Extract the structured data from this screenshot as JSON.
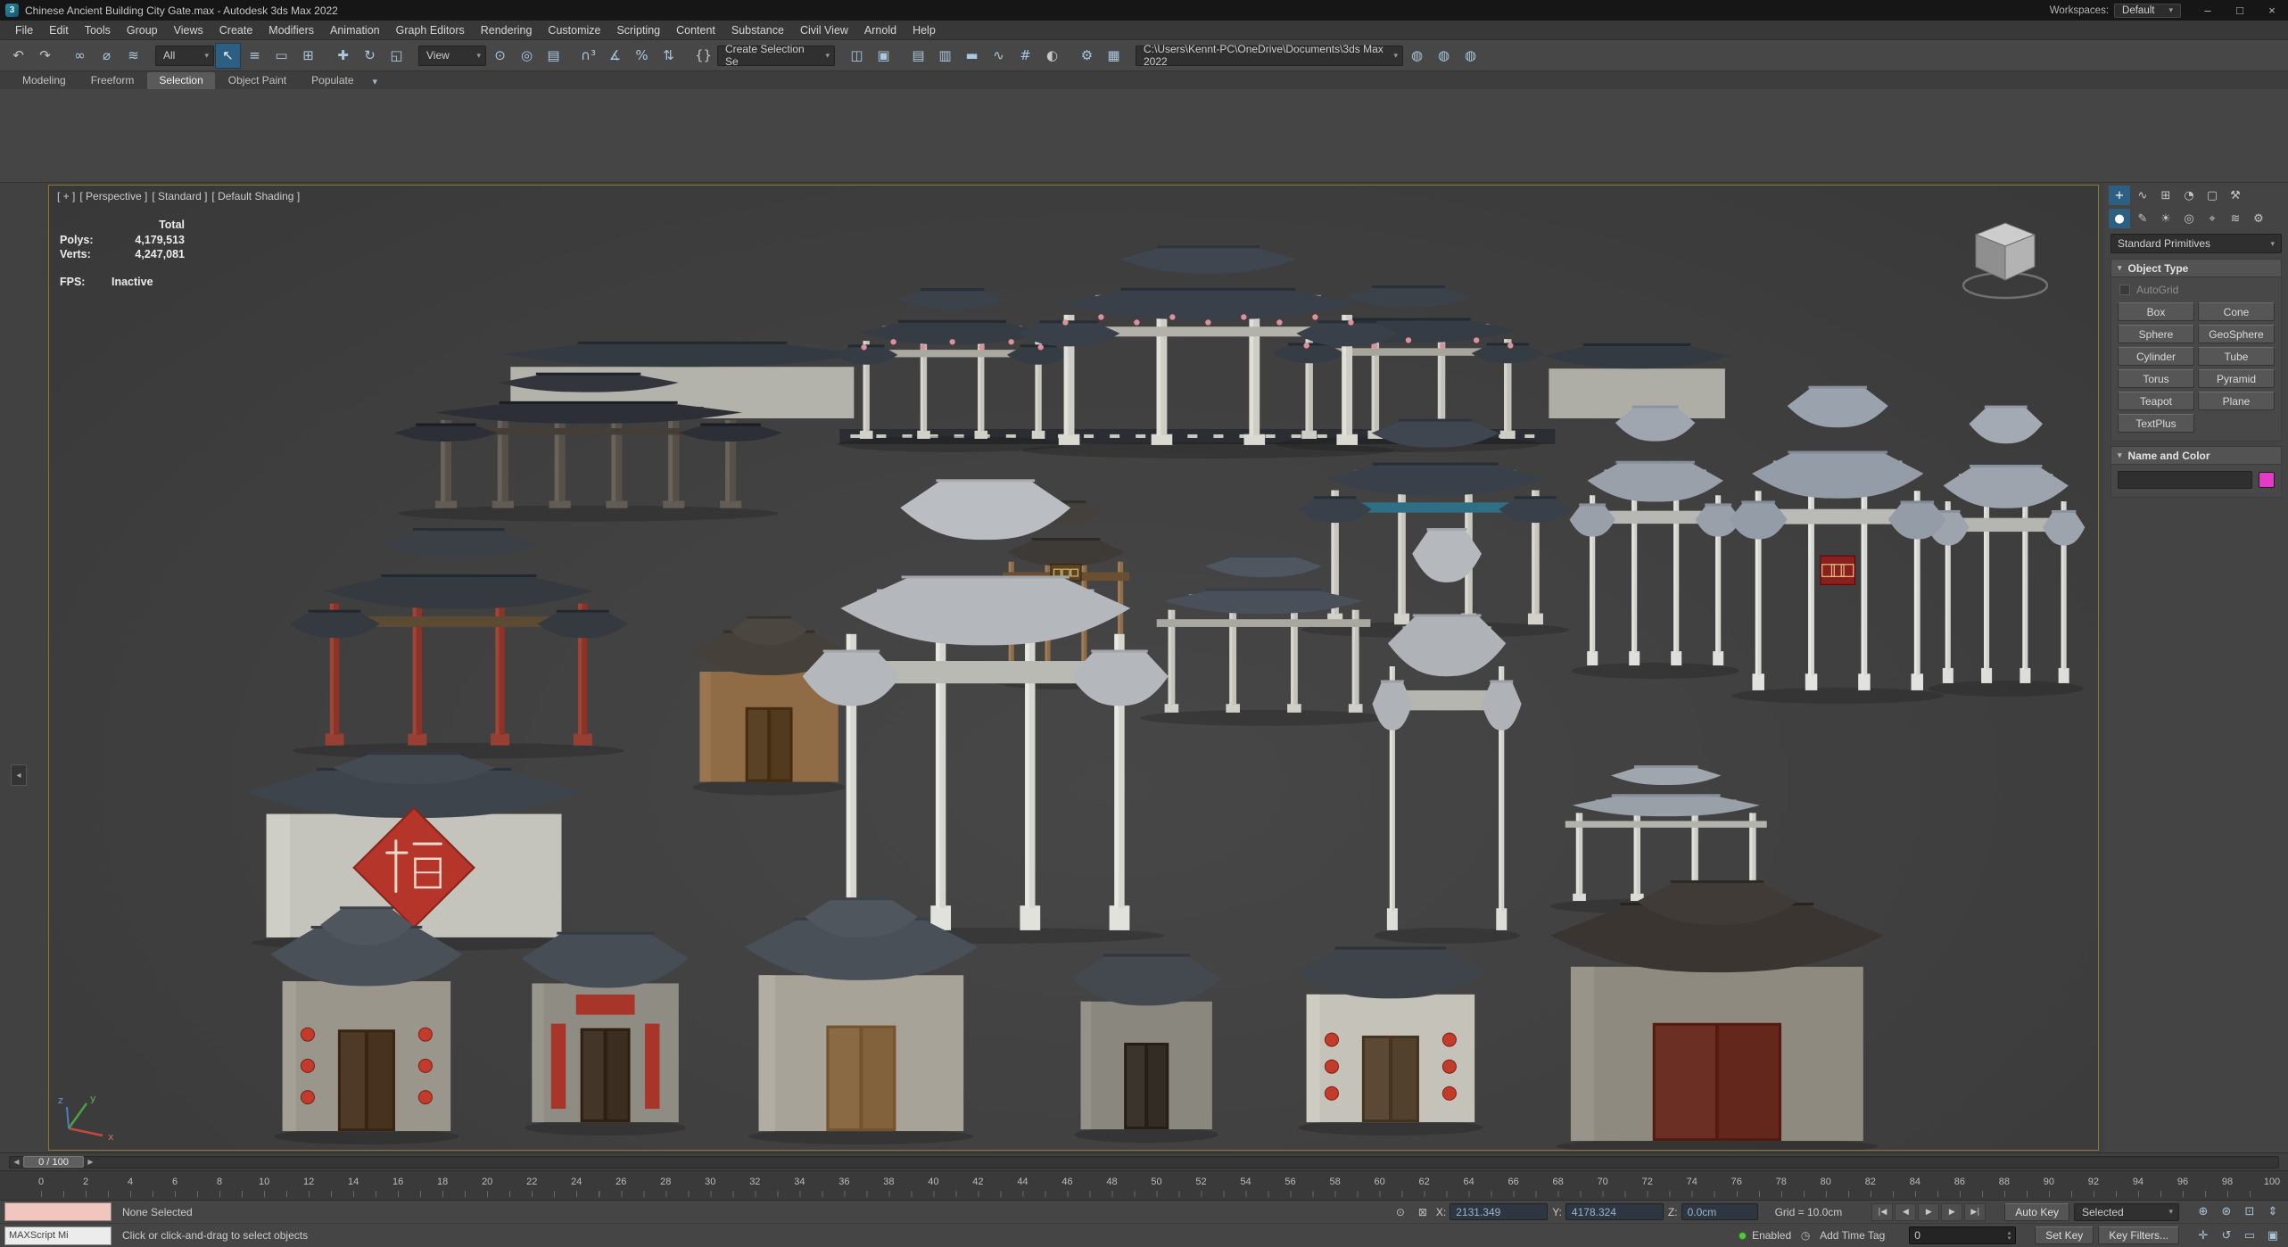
{
  "window": {
    "title": "Chinese Ancient Building City Gate.max - Autodesk 3ds Max 2022",
    "workspaces_label": "Workspaces:",
    "workspaces_value": "Default"
  },
  "menus": [
    "File",
    "Edit",
    "Tools",
    "Group",
    "Views",
    "Create",
    "Modifiers",
    "Animation",
    "Graph Editors",
    "Rendering",
    "Customize",
    "Scripting",
    "Content",
    "Substance",
    "Civil View",
    "Arnold",
    "Help"
  ],
  "toolbar": {
    "selection_filter": "All",
    "ref_coord": "View",
    "selection_set_placeholder": "Create Selection Se",
    "project_path": "C:\\Users\\Kennt-PC\\OneDrive\\Documents\\3ds Max 2022"
  },
  "ribbon": {
    "tabs": [
      "Modeling",
      "Freeform",
      "Selection",
      "Object Paint",
      "Populate"
    ],
    "active_tab": "Selection"
  },
  "viewport": {
    "label_segments": [
      "[ + ]",
      "[ Perspective ]",
      "[ Standard ]",
      "[ Default Shading ]"
    ],
    "stats": {
      "total_label": "Total",
      "polys_label": "Polys:",
      "polys_value": "4,179,513",
      "verts_label": "Verts:",
      "verts_value": "4,247,081",
      "fps_label": "FPS:",
      "fps_value": "Inactive"
    },
    "scene_signs": {
      "diamond_plaque": "福",
      "red_plaque": "越秀山"
    },
    "axis_labels": {
      "x": "x",
      "y": "y",
      "z": "z"
    }
  },
  "command_panel": {
    "primitives_dropdown": "Standard Primitives",
    "object_type_rollout": "Object Type",
    "autogrid_label": "AutoGrid",
    "object_buttons": [
      [
        "Box",
        "Cone"
      ],
      [
        "Sphere",
        "GeoSphere"
      ],
      [
        "Cylinder",
        "Tube"
      ],
      [
        "Torus",
        "Pyramid"
      ],
      [
        "Teapot",
        "Plane"
      ],
      [
        "TextPlus",
        ""
      ]
    ],
    "name_color_rollout": "Name and Color",
    "object_color": "#e23bc8"
  },
  "timeline": {
    "slider_value": "0 / 100",
    "start": 0,
    "end": 100,
    "label_step": 2
  },
  "status": {
    "listener_text": "MAXScript Mi",
    "selection_status": "None Selected",
    "prompt": "Click or click-and-drag to select objects",
    "coords": {
      "x_label": "X:",
      "x_value": "2131.349",
      "y_label": "Y:",
      "y_value": "4178.324",
      "z_label": "Z:",
      "z_value": "0.0cm"
    },
    "grid_label": "Grid = 10.0cm",
    "enabled_label": "Enabled",
    "add_time_tag": "Add Time Tag",
    "auto_key": "Auto Key",
    "set_key": "Set Key",
    "key_mode": "Selected",
    "key_filters": "Key Filters...",
    "frame_value": "0"
  },
  "icons": {
    "app_logo": "3",
    "minimize": "–",
    "maximize": "□",
    "close": "×",
    "dropdown": "▾",
    "undo": "↶",
    "redo": "↷",
    "link": "∞",
    "unlink": "⌀",
    "bind_spacewarp": "≋",
    "select_object": "↖",
    "select_by_name": "≡",
    "select_region": "▭",
    "window_crossing": "⊞",
    "move": "✚",
    "rotate": "↻",
    "scale": "◱",
    "ref_center": "⊙",
    "manipulate": "◎",
    "keyboard_override": "▤",
    "snap_toggle": "∩³",
    "angle_snap": "∡",
    "percent_snap": "%",
    "spinner_snap": "⇅",
    "named_sets": "{}",
    "mirror": "◫",
    "align": "▣",
    "scene_explorer": "▤",
    "layer_explorer": "▥",
    "ribbon_toggle": "▬",
    "curve_editor": "∿",
    "schematic_view": "#",
    "material_editor": "◐",
    "render_setup": "⚙",
    "render_frame": "▦",
    "render": "◍",
    "cmd_create": "+",
    "cmd_modify": "∿",
    "cmd_hierarchy": "⊞",
    "cmd_motion": "◔",
    "cmd_display": "▢",
    "cmd_utilities": "⚒",
    "cat_geometry": "●",
    "cat_shapes": "✎",
    "cat_lights": "☀",
    "cat_cameras": "◎",
    "cat_helpers": "⌖",
    "cat_spacewarps": "≋",
    "cat_systems": "⚙",
    "rollout_arrow": "▾",
    "isolate": "⊙",
    "lock": "⊠",
    "play_start": "|◀",
    "play_prev": "◀",
    "play": "▶",
    "play_next": "▶",
    "play_end": "▶|",
    "clock": "◷",
    "spin_up": "▴",
    "spin_down": "▾",
    "nav_zoom": "⊕",
    "nav_zoom_all": "⊛",
    "nav_zoom_extents": "⊡",
    "nav_zoom_region": "▭",
    "nav_pan": "✛",
    "nav_orbit": "↺",
    "nav_dolly": "⇕",
    "nav_maximize": "▣",
    "viewport_tab": "◂",
    "slider_prev": "◀",
    "slider_next": "▶"
  }
}
